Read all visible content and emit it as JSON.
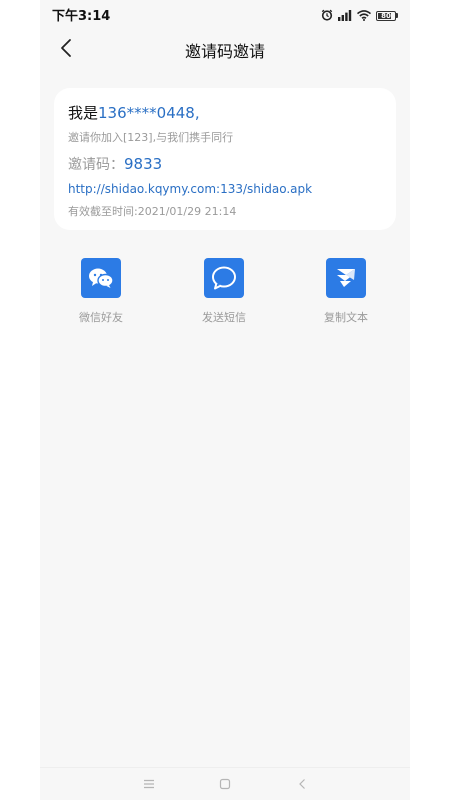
{
  "status_bar": {
    "time": "下午3:14",
    "battery_level": "80",
    "battery_fraction": 0.8
  },
  "header": {
    "title": "邀请码邀请",
    "back_icon": "chevron-left-icon"
  },
  "invite_card": {
    "intro_prefix": "我是",
    "phone_number": "136****0448,",
    "join_text": "邀请你加入[123],与我们携手同行",
    "code_label": "邀请码：",
    "code_value": "9833",
    "download_link": "http://shidao.kqymy.com:133/shidao.apk",
    "expiry_label": "有效截至时间:",
    "expiry_value": "2021/01/29 21:14"
  },
  "share_options": [
    {
      "label": "微信好友",
      "icon": "wechat-icon"
    },
    {
      "label": "发送短信",
      "icon": "sms-icon"
    },
    {
      "label": "复制文本",
      "icon": "copy-text-icon"
    }
  ],
  "colors": {
    "accent": "#2c7be5",
    "link": "#2a6fc4",
    "muted_text": "#9a9a9a",
    "background": "#f7f7f7",
    "card": "#ffffff"
  },
  "nav_bar": {
    "icons": [
      "menu-icon",
      "home-icon",
      "back-icon"
    ]
  }
}
